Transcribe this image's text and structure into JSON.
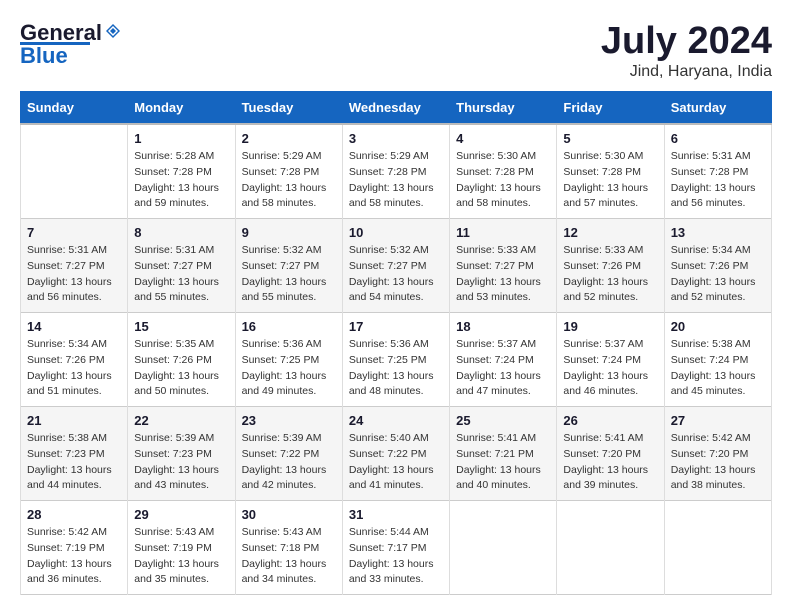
{
  "logo": {
    "general": "General",
    "blue": "Blue"
  },
  "title": {
    "month": "July 2024",
    "location": "Jind, Haryana, India"
  },
  "headers": [
    "Sunday",
    "Monday",
    "Tuesday",
    "Wednesday",
    "Thursday",
    "Friday",
    "Saturday"
  ],
  "weeks": [
    [
      {
        "day": "",
        "sunrise": "",
        "sunset": "",
        "daylight": ""
      },
      {
        "day": "1",
        "sunrise": "Sunrise: 5:28 AM",
        "sunset": "Sunset: 7:28 PM",
        "daylight": "Daylight: 13 hours and 59 minutes."
      },
      {
        "day": "2",
        "sunrise": "Sunrise: 5:29 AM",
        "sunset": "Sunset: 7:28 PM",
        "daylight": "Daylight: 13 hours and 58 minutes."
      },
      {
        "day": "3",
        "sunrise": "Sunrise: 5:29 AM",
        "sunset": "Sunset: 7:28 PM",
        "daylight": "Daylight: 13 hours and 58 minutes."
      },
      {
        "day": "4",
        "sunrise": "Sunrise: 5:30 AM",
        "sunset": "Sunset: 7:28 PM",
        "daylight": "Daylight: 13 hours and 58 minutes."
      },
      {
        "day": "5",
        "sunrise": "Sunrise: 5:30 AM",
        "sunset": "Sunset: 7:28 PM",
        "daylight": "Daylight: 13 hours and 57 minutes."
      },
      {
        "day": "6",
        "sunrise": "Sunrise: 5:31 AM",
        "sunset": "Sunset: 7:28 PM",
        "daylight": "Daylight: 13 hours and 56 minutes."
      }
    ],
    [
      {
        "day": "7",
        "sunrise": "Sunrise: 5:31 AM",
        "sunset": "Sunset: 7:27 PM",
        "daylight": "Daylight: 13 hours and 56 minutes."
      },
      {
        "day": "8",
        "sunrise": "Sunrise: 5:31 AM",
        "sunset": "Sunset: 7:27 PM",
        "daylight": "Daylight: 13 hours and 55 minutes."
      },
      {
        "day": "9",
        "sunrise": "Sunrise: 5:32 AM",
        "sunset": "Sunset: 7:27 PM",
        "daylight": "Daylight: 13 hours and 55 minutes."
      },
      {
        "day": "10",
        "sunrise": "Sunrise: 5:32 AM",
        "sunset": "Sunset: 7:27 PM",
        "daylight": "Daylight: 13 hours and 54 minutes."
      },
      {
        "day": "11",
        "sunrise": "Sunrise: 5:33 AM",
        "sunset": "Sunset: 7:27 PM",
        "daylight": "Daylight: 13 hours and 53 minutes."
      },
      {
        "day": "12",
        "sunrise": "Sunrise: 5:33 AM",
        "sunset": "Sunset: 7:26 PM",
        "daylight": "Daylight: 13 hours and 52 minutes."
      },
      {
        "day": "13",
        "sunrise": "Sunrise: 5:34 AM",
        "sunset": "Sunset: 7:26 PM",
        "daylight": "Daylight: 13 hours and 52 minutes."
      }
    ],
    [
      {
        "day": "14",
        "sunrise": "Sunrise: 5:34 AM",
        "sunset": "Sunset: 7:26 PM",
        "daylight": "Daylight: 13 hours and 51 minutes."
      },
      {
        "day": "15",
        "sunrise": "Sunrise: 5:35 AM",
        "sunset": "Sunset: 7:26 PM",
        "daylight": "Daylight: 13 hours and 50 minutes."
      },
      {
        "day": "16",
        "sunrise": "Sunrise: 5:36 AM",
        "sunset": "Sunset: 7:25 PM",
        "daylight": "Daylight: 13 hours and 49 minutes."
      },
      {
        "day": "17",
        "sunrise": "Sunrise: 5:36 AM",
        "sunset": "Sunset: 7:25 PM",
        "daylight": "Daylight: 13 hours and 48 minutes."
      },
      {
        "day": "18",
        "sunrise": "Sunrise: 5:37 AM",
        "sunset": "Sunset: 7:24 PM",
        "daylight": "Daylight: 13 hours and 47 minutes."
      },
      {
        "day": "19",
        "sunrise": "Sunrise: 5:37 AM",
        "sunset": "Sunset: 7:24 PM",
        "daylight": "Daylight: 13 hours and 46 minutes."
      },
      {
        "day": "20",
        "sunrise": "Sunrise: 5:38 AM",
        "sunset": "Sunset: 7:24 PM",
        "daylight": "Daylight: 13 hours and 45 minutes."
      }
    ],
    [
      {
        "day": "21",
        "sunrise": "Sunrise: 5:38 AM",
        "sunset": "Sunset: 7:23 PM",
        "daylight": "Daylight: 13 hours and 44 minutes."
      },
      {
        "day": "22",
        "sunrise": "Sunrise: 5:39 AM",
        "sunset": "Sunset: 7:23 PM",
        "daylight": "Daylight: 13 hours and 43 minutes."
      },
      {
        "day": "23",
        "sunrise": "Sunrise: 5:39 AM",
        "sunset": "Sunset: 7:22 PM",
        "daylight": "Daylight: 13 hours and 42 minutes."
      },
      {
        "day": "24",
        "sunrise": "Sunrise: 5:40 AM",
        "sunset": "Sunset: 7:22 PM",
        "daylight": "Daylight: 13 hours and 41 minutes."
      },
      {
        "day": "25",
        "sunrise": "Sunrise: 5:41 AM",
        "sunset": "Sunset: 7:21 PM",
        "daylight": "Daylight: 13 hours and 40 minutes."
      },
      {
        "day": "26",
        "sunrise": "Sunrise: 5:41 AM",
        "sunset": "Sunset: 7:20 PM",
        "daylight": "Daylight: 13 hours and 39 minutes."
      },
      {
        "day": "27",
        "sunrise": "Sunrise: 5:42 AM",
        "sunset": "Sunset: 7:20 PM",
        "daylight": "Daylight: 13 hours and 38 minutes."
      }
    ],
    [
      {
        "day": "28",
        "sunrise": "Sunrise: 5:42 AM",
        "sunset": "Sunset: 7:19 PM",
        "daylight": "Daylight: 13 hours and 36 minutes."
      },
      {
        "day": "29",
        "sunrise": "Sunrise: 5:43 AM",
        "sunset": "Sunset: 7:19 PM",
        "daylight": "Daylight: 13 hours and 35 minutes."
      },
      {
        "day": "30",
        "sunrise": "Sunrise: 5:43 AM",
        "sunset": "Sunset: 7:18 PM",
        "daylight": "Daylight: 13 hours and 34 minutes."
      },
      {
        "day": "31",
        "sunrise": "Sunrise: 5:44 AM",
        "sunset": "Sunset: 7:17 PM",
        "daylight": "Daylight: 13 hours and 33 minutes."
      },
      {
        "day": "",
        "sunrise": "",
        "sunset": "",
        "daylight": ""
      },
      {
        "day": "",
        "sunrise": "",
        "sunset": "",
        "daylight": ""
      },
      {
        "day": "",
        "sunrise": "",
        "sunset": "",
        "daylight": ""
      }
    ]
  ]
}
